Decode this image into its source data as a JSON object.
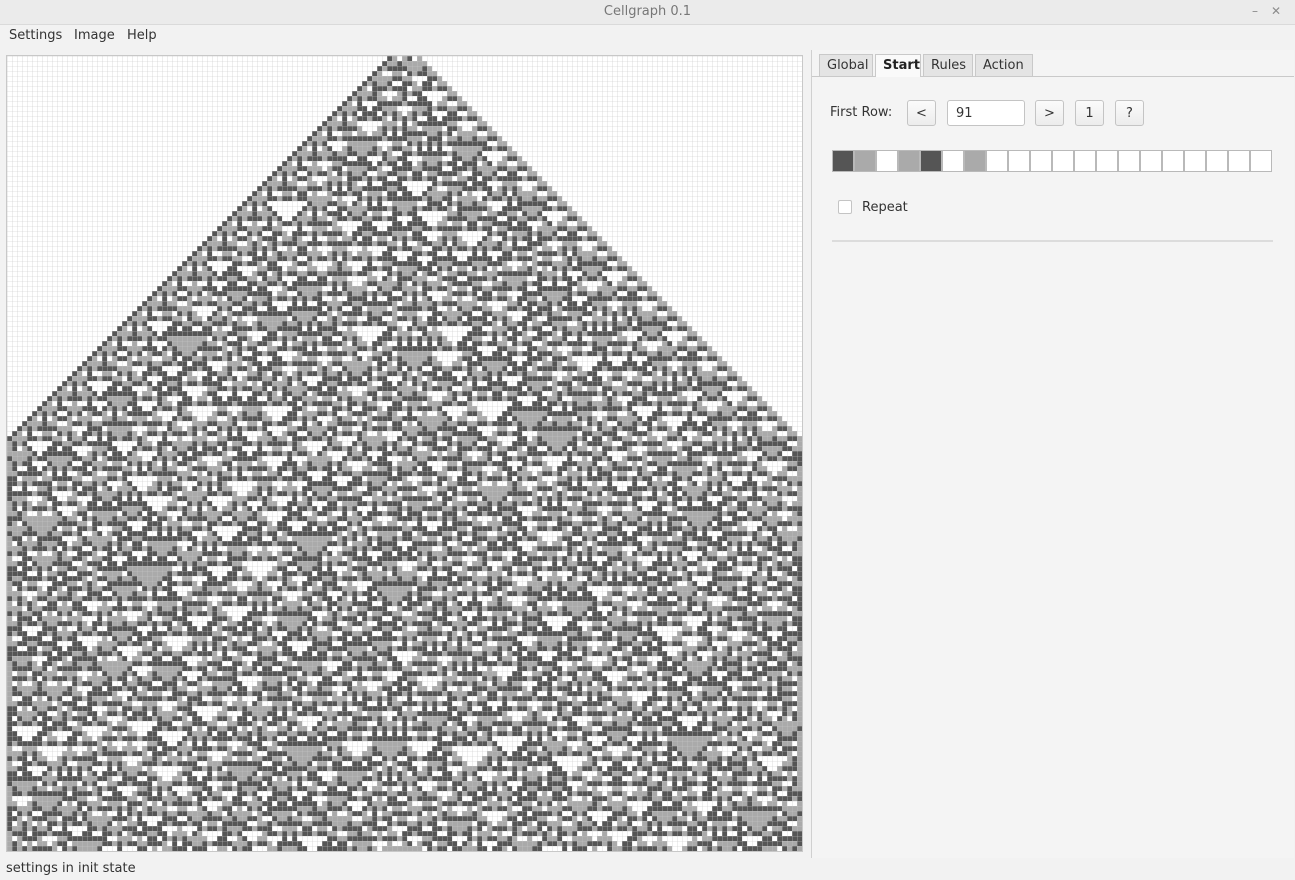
{
  "window": {
    "title": "Cellgraph 0.1",
    "minimize_glyph": "–",
    "close_glyph": "✕"
  },
  "menubar": {
    "items": [
      "Settings",
      "Image",
      "Help"
    ]
  },
  "tabs": [
    {
      "label": "Global",
      "active": false
    },
    {
      "label": "Start",
      "active": true
    },
    {
      "label": "Rules",
      "active": false
    },
    {
      "label": "Action",
      "active": false
    }
  ],
  "start_tab": {
    "first_row_label": "First Row:",
    "prev_button": "<",
    "row_value": "91",
    "next_button": ">",
    "one_button": "1",
    "random_button": "?",
    "start_cells": [
      "#555555",
      "#aaaaaa",
      "#ffffff",
      "#aaaaaa",
      "#555555",
      "#ffffff",
      "#aaaaaa",
      "#ffffff",
      "#ffffff",
      "#ffffff",
      "#ffffff",
      "#ffffff",
      "#ffffff",
      "#ffffff",
      "#ffffff",
      "#ffffff",
      "#ffffff",
      "#ffffff",
      "#ffffff",
      "#ffffff"
    ],
    "repeat_label": "Repeat",
    "repeat_checked": false
  },
  "automaton": {
    "state_colors": [
      "#ffffff",
      "#aaaaaa",
      "#555555",
      "#000000"
    ],
    "cell_border_color": "#c7c7c7"
  },
  "status": {
    "text": "settings in init state"
  }
}
